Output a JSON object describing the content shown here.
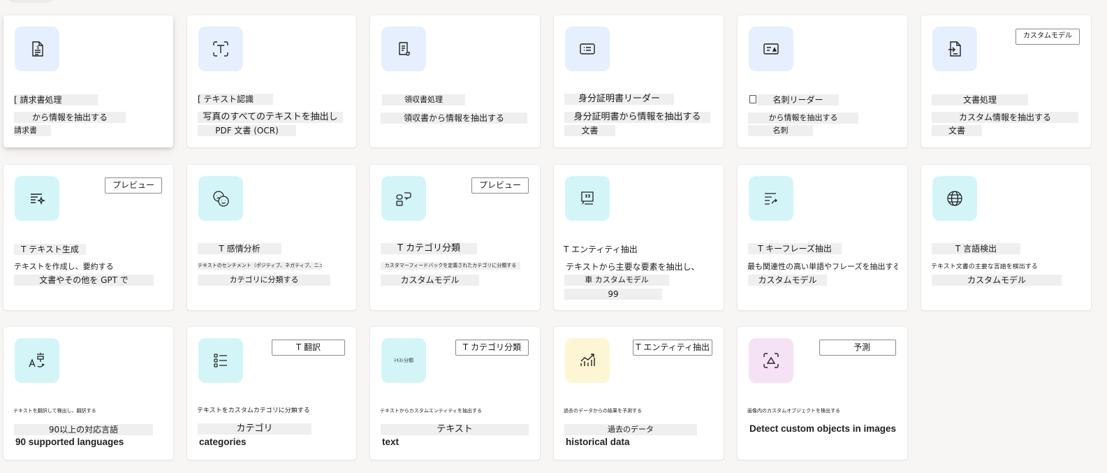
{
  "cards": [
    {
      "title": "[ 請求書処理",
      "desc1": "から情報を抽出する",
      "desc2": "請求書",
      "icon": "invoice-icon"
    },
    {
      "title": "[ テキスト認識",
      "desc1": "写真のすべてのテキストを抽出し",
      "desc2": "PDF 文書 (OCR)",
      "icon": "text-recognition-icon"
    },
    {
      "title": "領収書処理",
      "desc1": "領収書から情報を抽出する",
      "icon": "receipt-icon"
    },
    {
      "title": "身分証明書リーダー",
      "desc1": "身分証明書から情報を抽出する",
      "desc2": "文書",
      "icon": "id-card-icon"
    },
    {
      "title": "名刺リーダー",
      "desc1": "から情報を抽出する",
      "desc2": "名刺",
      "icon": "business-card-icon"
    },
    {
      "badge": "カスタムモデル",
      "title": "文書処理",
      "desc1": "カスタム情報を抽出する",
      "desc2": "文書",
      "icon": "document-processing-icon"
    },
    {
      "badge": "プレビュー",
      "title": "T テキスト生成",
      "desc1": "テキストを作成し、要約する",
      "desc2": "文書やその他を GPT で",
      "icon": "text-generation-icon"
    },
    {
      "title": "T 感情分析",
      "desc1": "テキストのセンチメント（ポジティブ、ネガティブ、ニュートラル）を検出して分類する",
      "desc2": "カテゴリに分類する",
      "icon": "sentiment-icon"
    },
    {
      "badge": "プレビュー",
      "title": "T カテゴリ分類",
      "desc1": "カスタマーフィードバックを定義されたカテゴリに分類する",
      "desc2": "カスタムモデル",
      "icon": "category-classification-icon"
    },
    {
      "title": "T エンティティ抽出",
      "desc1": "テキストから主要な要素を抽出し、",
      "desc2": "車 カスタムモデル",
      "desc3": "99",
      "icon": "entity-extraction-icon"
    },
    {
      "title": "T キーフレーズ抽出",
      "desc1": "最も関連性の高い単語やフレーズを抽出する",
      "desc2": "カスタムモデル",
      "icon": "key-phrase-icon"
    },
    {
      "title": "T 言語検出",
      "desc1": "テキスト文書の主要な言語を検出する",
      "desc2": "カスタムモデル",
      "icon": "globe-icon"
    },
    {
      "desc1": "テキストを翻訳して検出し、翻訳する",
      "desc2": "90以上の対応言語",
      "en": "90 supported languages",
      "icon": "translation-icon"
    },
    {
      "badge": "T 翻訳",
      "desc1": "テキストをカスタムカテゴリに分類する",
      "desc2": "カテゴリ",
      "en": "categories",
      "icon": "list-icon"
    },
    {
      "badge": "T カテゴリ分類",
      "tile_label": "ﾃｷｽﾄ分類",
      "desc1": "テキストからカスタムエンティティを抽出する",
      "desc2": "テキスト",
      "en": "text",
      "icon": "text-label-icon"
    },
    {
      "badge": "T エンティティ抽出",
      "desc1": "過去のデータからの結果を予測する",
      "desc2": "過去のデータ",
      "en": "historical data",
      "icon": "chart-icon"
    },
    {
      "badge": "予測",
      "desc1": "画像内のカスタムオブジェクトを検出する",
      "en": "Detect custom objects in images",
      "icon": "object-detection-icon"
    }
  ]
}
